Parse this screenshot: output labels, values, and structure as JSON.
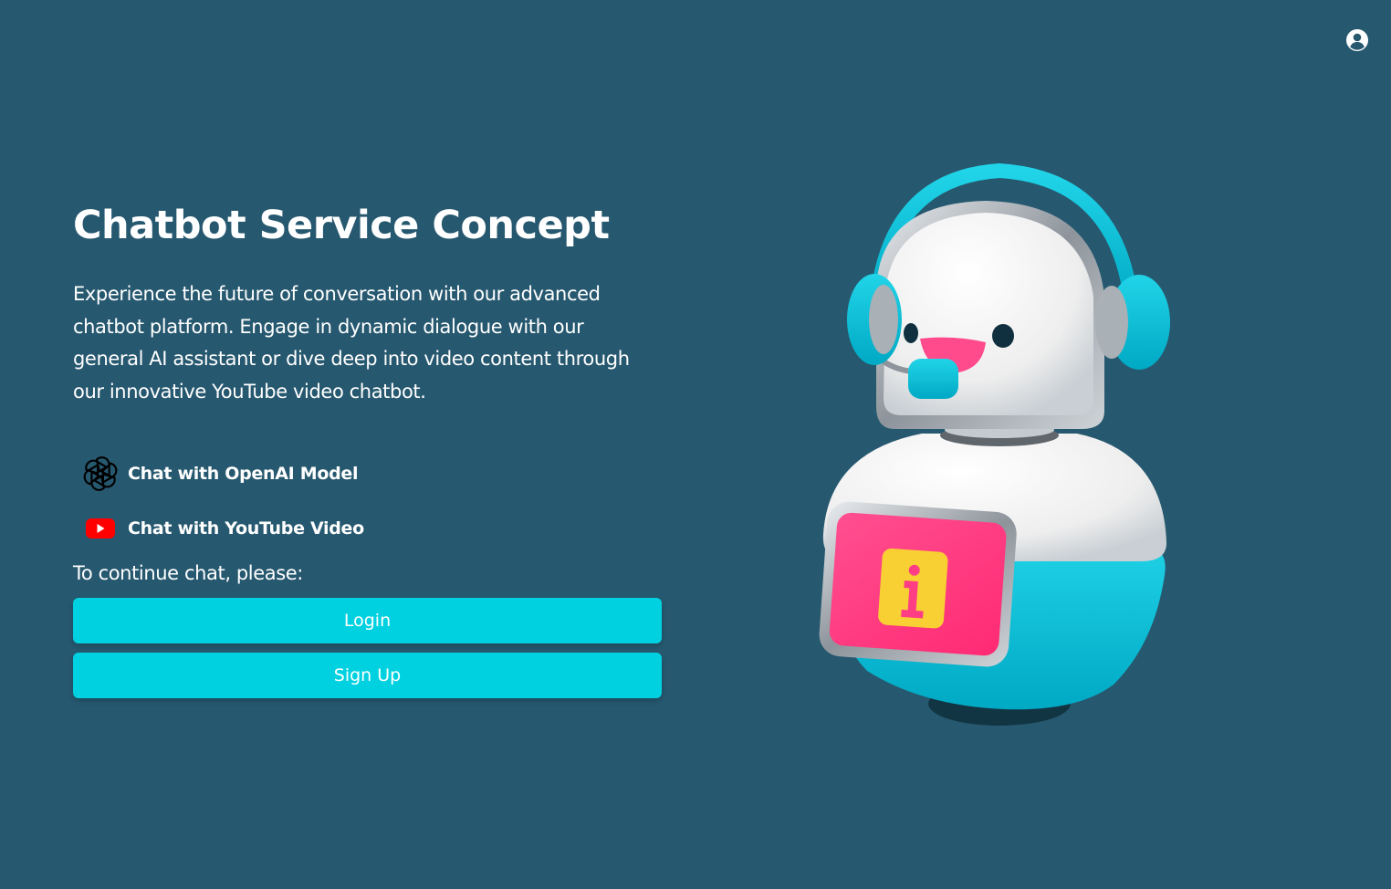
{
  "header": {
    "account_icon": "user-circle-icon"
  },
  "hero": {
    "title": "Chatbot Service Concept",
    "description": "Experience the future of conversation with our advanced chatbot platform. Engage in dynamic dialogue with our general AI assistant or dive deep into video content through our innovative YouTube video chatbot."
  },
  "features": [
    {
      "label": "Chat with OpenAI Model",
      "icon": "openai-logo-icon"
    },
    {
      "label": "Chat with YouTube Video",
      "icon": "youtube-logo-icon"
    }
  ],
  "auth": {
    "prompt": "To continue chat, please:",
    "login_label": "Login",
    "signup_label": "Sign Up"
  },
  "colors": {
    "background": "#26586f",
    "button": "#00d1e0",
    "youtube_red": "#ff0000",
    "robot_cyan": "#00c3d8",
    "robot_pink": "#ff3d84",
    "robot_yellow": "#f8d034"
  }
}
